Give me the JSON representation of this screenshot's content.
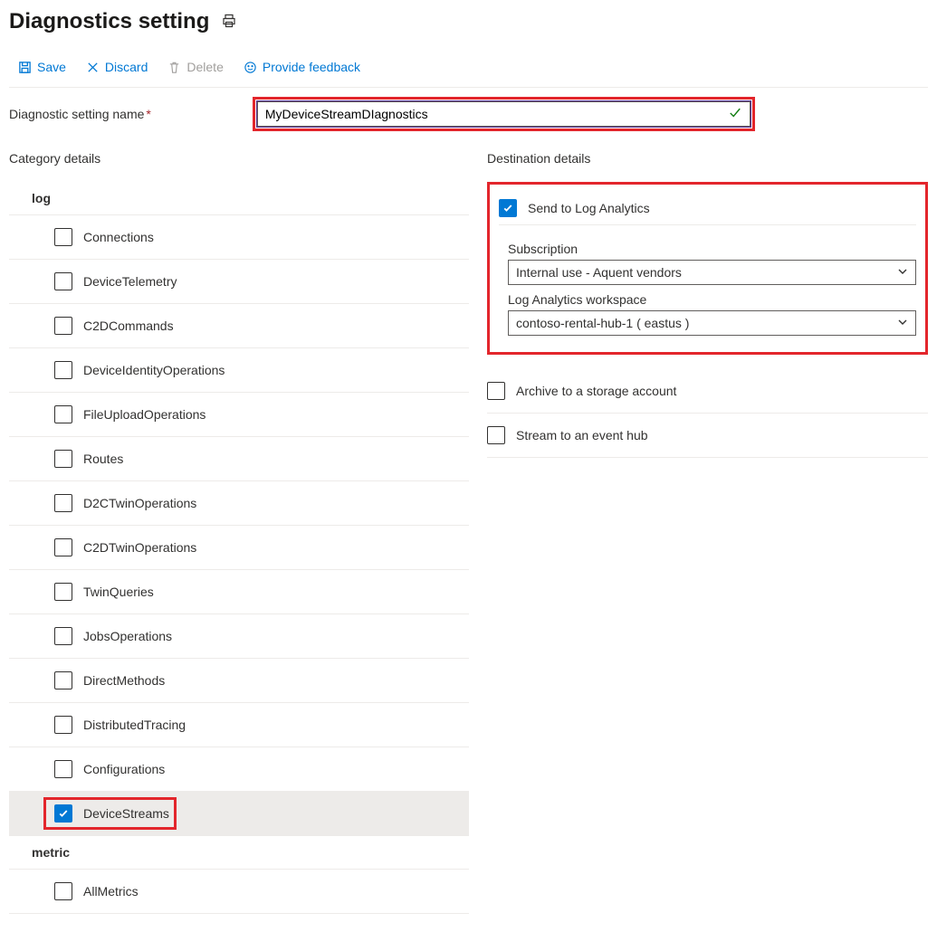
{
  "page": {
    "title": "Diagnostics setting"
  },
  "toolbar": {
    "save": "Save",
    "discard": "Discard",
    "delete": "Delete",
    "feedback": "Provide feedback"
  },
  "nameField": {
    "label": "Diagnostic setting name",
    "value": "MyDeviceStreamDIagnostics"
  },
  "categories": {
    "title": "Category details",
    "logHeading": "log",
    "metricHeading": "metric",
    "logs": [
      {
        "label": "Connections",
        "checked": false
      },
      {
        "label": "DeviceTelemetry",
        "checked": false
      },
      {
        "label": "C2DCommands",
        "checked": false
      },
      {
        "label": "DeviceIdentityOperations",
        "checked": false
      },
      {
        "label": "FileUploadOperations",
        "checked": false
      },
      {
        "label": "Routes",
        "checked": false
      },
      {
        "label": "D2CTwinOperations",
        "checked": false
      },
      {
        "label": "C2DTwinOperations",
        "checked": false
      },
      {
        "label": "TwinQueries",
        "checked": false
      },
      {
        "label": "JobsOperations",
        "checked": false
      },
      {
        "label": "DirectMethods",
        "checked": false
      },
      {
        "label": "DistributedTracing",
        "checked": false
      },
      {
        "label": "Configurations",
        "checked": false
      },
      {
        "label": "DeviceStreams",
        "checked": true
      }
    ],
    "metrics": [
      {
        "label": "AllMetrics",
        "checked": false
      }
    ]
  },
  "destinations": {
    "title": "Destination details",
    "sendToLogAnalytics": {
      "label": "Send to Log Analytics",
      "checked": true
    },
    "subscription": {
      "label": "Subscription",
      "value": "Internal use - Aquent vendors"
    },
    "workspace": {
      "label": "Log Analytics workspace",
      "value": "contoso-rental-hub-1 ( eastus )"
    },
    "archive": {
      "label": "Archive to a storage account",
      "checked": false
    },
    "stream": {
      "label": "Stream to an event hub",
      "checked": false
    }
  }
}
